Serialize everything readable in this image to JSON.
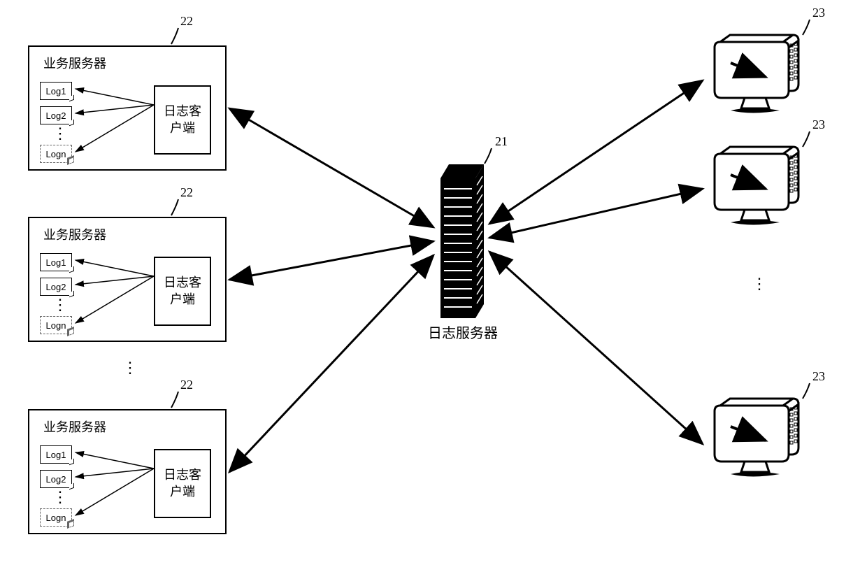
{
  "refs": {
    "central": "21",
    "server_box": "22",
    "terminal": "23"
  },
  "labels": {
    "biz_server": "业务服务器",
    "log_client": "日志客\n户端",
    "central_server": "日志服务器"
  },
  "logs": [
    "Log1",
    "Log2",
    "Logn"
  ]
}
